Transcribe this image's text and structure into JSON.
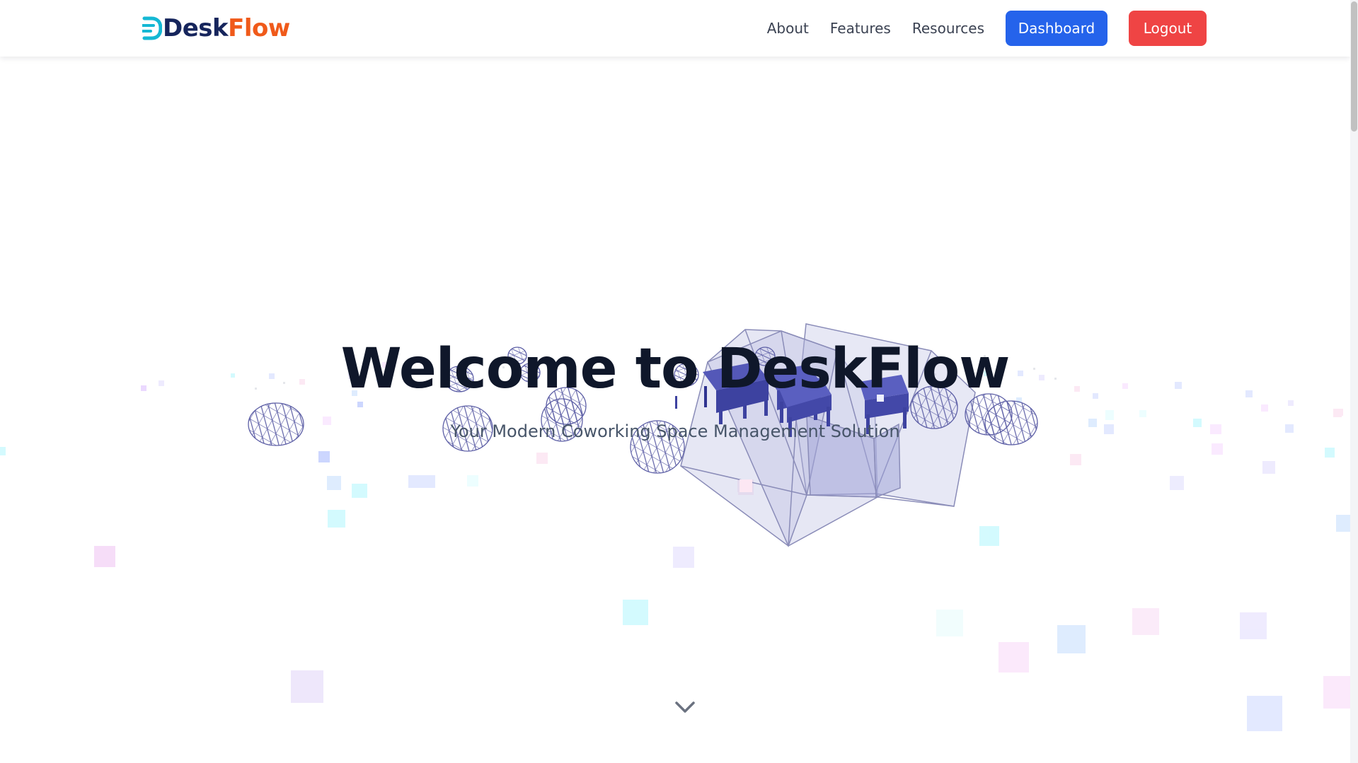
{
  "header": {
    "logo_prefix": "Desk",
    "logo_suffix": "Flow",
    "nav": [
      {
        "label": "About"
      },
      {
        "label": "Features"
      },
      {
        "label": "Resources"
      }
    ],
    "dashboard_label": "Dashboard",
    "logout_label": "Logout"
  },
  "hero": {
    "title": "Welcome to DeskFlow",
    "subtitle": "Your Modern Coworking Space Management Solution"
  },
  "icons": {
    "logo": "deskflow-logo-icon",
    "scroll": "chevron-down-icon"
  },
  "colors": {
    "brand_navy": "#16255c",
    "brand_orange": "#f05a1a",
    "brand_cyan": "#14b8d4",
    "primary": "#2563eb",
    "danger": "#ef4444",
    "title": "#0f172a",
    "subtitle": "#475569"
  }
}
